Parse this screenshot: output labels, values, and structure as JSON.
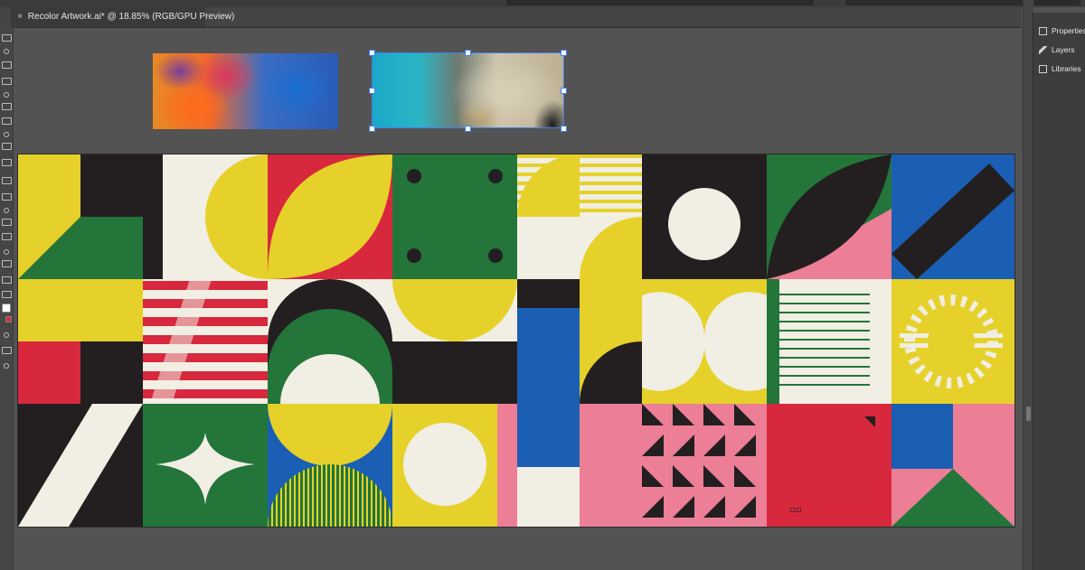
{
  "document_tab": {
    "close_glyph": "×",
    "title": "Recolor Artwork.ai* @ 18.85% (RGB/GPU Preview)"
  },
  "panels": {
    "items": [
      {
        "label": "Properties",
        "icon": "properties-icon"
      },
      {
        "label": "Layers",
        "icon": "layers-icon"
      },
      {
        "label": "Libraries",
        "icon": "libraries-icon"
      }
    ]
  },
  "artboard": {
    "zoom": "18.85%",
    "color_mode": "RGB/GPU Preview",
    "small_mark": "▫▫"
  },
  "colors": {
    "yellow": "#e5d12a",
    "black": "#231f20",
    "cream": "#f1eee3",
    "red": "#d8283d",
    "green": "#23753a",
    "blue": "#1a5fb4",
    "pink": "#ec7e96",
    "selection": "#3d7ff0"
  }
}
